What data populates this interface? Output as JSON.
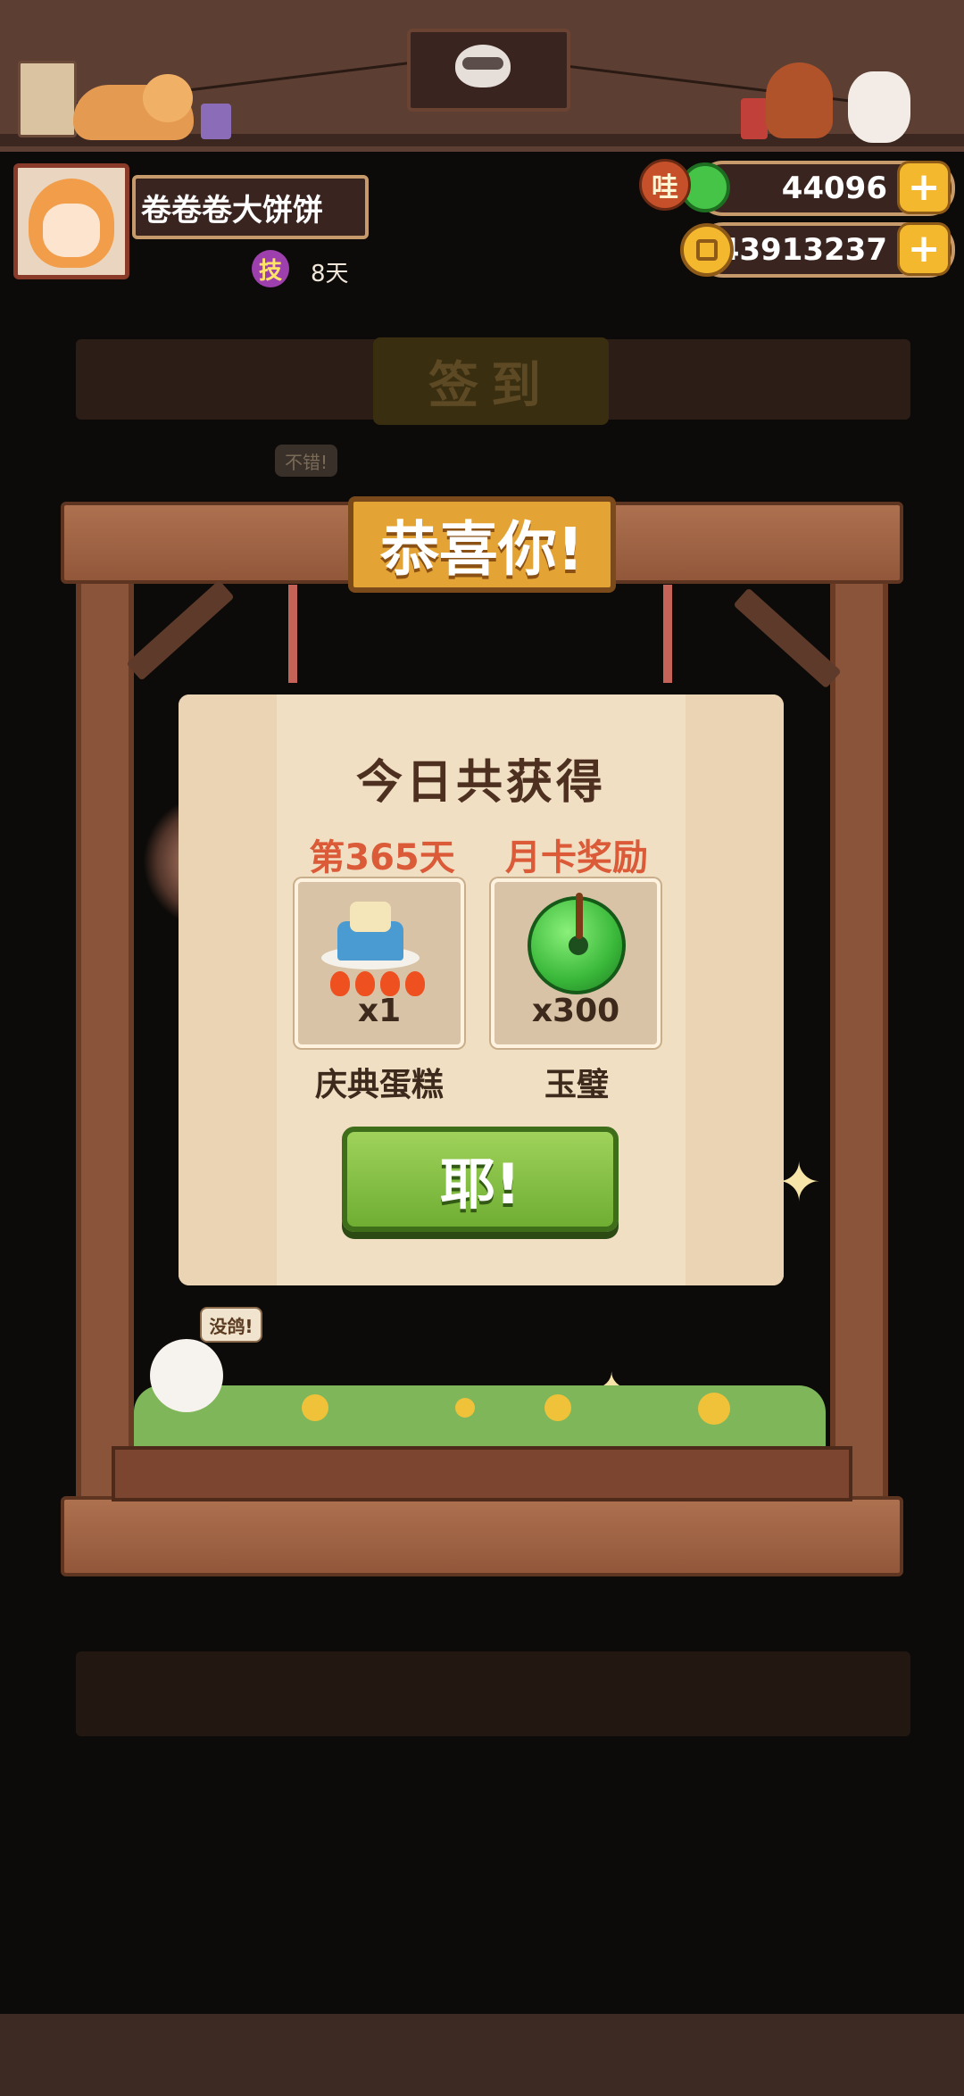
{
  "header": {
    "player_name": "卷卷卷大饼饼",
    "skill_icon_label": "技",
    "skill_days": "8天",
    "jade_badge_label": "哇",
    "jade_amount": "44096",
    "coin_amount": "43913237",
    "plus_label": "+"
  },
  "background": {
    "checkin_title": "签到",
    "npc_bubble": "不错!"
  },
  "dialog": {
    "banner": "恭喜你!",
    "title": "今日共获得",
    "rewards": [
      {
        "header": "第365天",
        "qty": "x1",
        "name": "庆典蛋糕",
        "icon": "celebration-cake-icon"
      },
      {
        "header": "月卡奖励",
        "qty": "x300",
        "name": "玉璧",
        "icon": "jade-disc-icon"
      }
    ],
    "confirm_label": "耶!"
  },
  "scene": {
    "bird_bubble": "没鸽!"
  },
  "colors": {
    "wood": "#92573a",
    "panel": "#f1dfc4",
    "accent_red": "#db5a38",
    "button_green": "#7fbf3f",
    "gold": "#f3b82d"
  }
}
